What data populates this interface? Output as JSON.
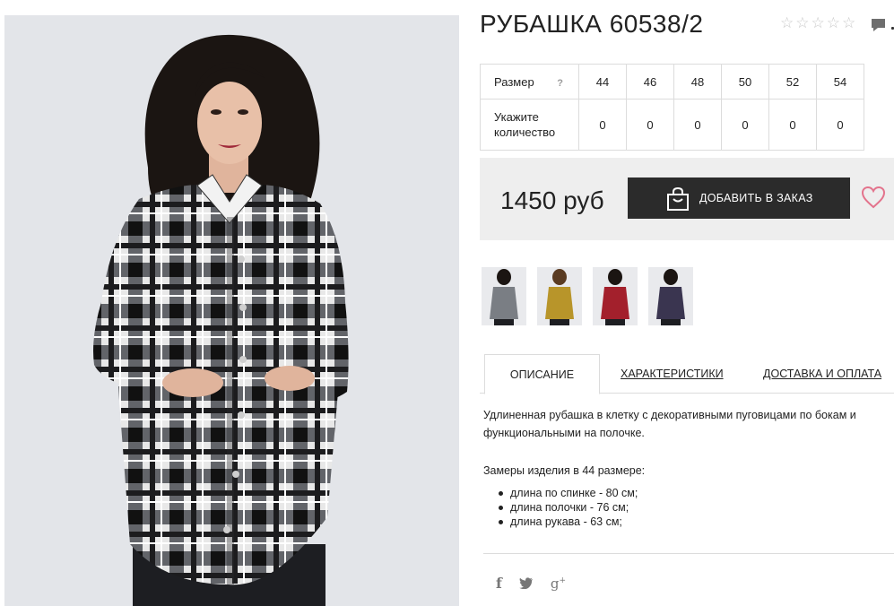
{
  "product": {
    "title": "РУБАШКА 60538/2",
    "rating_stars": 5,
    "rating_value": 0,
    "price": "1450 руб",
    "add_to_cart_label": "ДОБАВИТЬ В ЗАКАЗ"
  },
  "size_table": {
    "size_label": "Размер",
    "help_icon": "?",
    "quantity_label": "Укажите количество",
    "sizes": [
      "44",
      "46",
      "48",
      "50",
      "52",
      "54"
    ],
    "quantities": [
      "0",
      "0",
      "0",
      "0",
      "0",
      "0"
    ]
  },
  "thumbnails": [
    {
      "name": "thumb-gray",
      "color": "#7a7e84"
    },
    {
      "name": "thumb-yellow",
      "color": "#b8952a"
    },
    {
      "name": "thumb-red",
      "color": "#a3202c"
    },
    {
      "name": "thumb-navy",
      "color": "#3a3550"
    }
  ],
  "tabs": [
    "ОПИСАНИЕ",
    "ХАРАКТЕРИСТИКИ",
    "ДОСТАВКА И ОПЛАТА"
  ],
  "description": {
    "text": "Удлиненная рубашка в клетку с декоративными пуговицами по бокам и функциональными на полочке.",
    "measurements_title": "Замеры изделия в 44 размере:",
    "measurements": [
      "длина по спинке - 80 см;",
      "длина полочки - 76 см;",
      "длина рукава - 63 см;"
    ]
  },
  "social": [
    "facebook-icon",
    "twitter-icon",
    "google-plus-icon"
  ],
  "colors": {
    "accent_heart": "#e3738c",
    "button_bg": "#2b2b2b",
    "panel_bg": "#eeeeee"
  }
}
